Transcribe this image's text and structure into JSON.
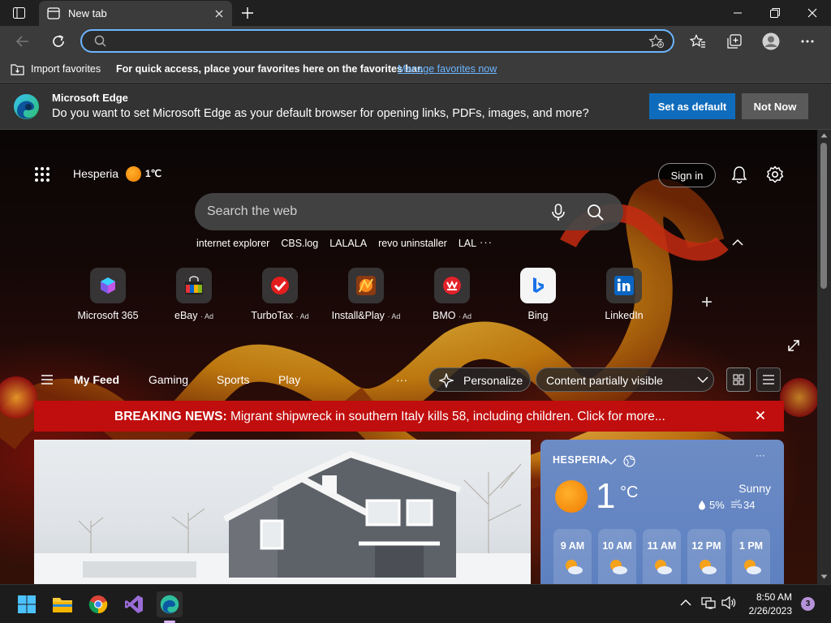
{
  "browser": {
    "tab_title": "New tab",
    "address_value": "",
    "address_placeholder": ""
  },
  "favorites_bar": {
    "import_label": "Import favorites",
    "hint": "For quick access, place your favorites here on the favorites bar.",
    "manage_link": "Manage favorites now"
  },
  "infobar": {
    "title": "Microsoft Edge",
    "message": "Do you want to set Microsoft Edge as your default browser for opening links, PDFs, images, and more?",
    "set_default": "Set as default",
    "not_now": "Not Now"
  },
  "page": {
    "location": "Hesperia",
    "temp_small": "1℃",
    "sign_in": "Sign in",
    "search_placeholder": "Search the web",
    "trending": [
      "internet explorer",
      "CBS.log",
      "LALALA",
      "revo uninstaller",
      "LAL"
    ],
    "more": "···"
  },
  "quick_links": [
    {
      "label": "Microsoft 365",
      "ad": ""
    },
    {
      "label": "eBay",
      "ad": "· Ad"
    },
    {
      "label": "TurboTax",
      "ad": "· Ad"
    },
    {
      "label": "Install&Play",
      "ad": "· Ad"
    },
    {
      "label": "BMO",
      "ad": "· Ad"
    },
    {
      "label": "Bing",
      "ad": ""
    },
    {
      "label": "LinkedIn",
      "ad": ""
    }
  ],
  "feed": {
    "tabs": [
      "My Feed",
      "Gaming",
      "Sports",
      "Play"
    ],
    "more": "···",
    "personalize": "Personalize",
    "content_visibility": "Content partially visible"
  },
  "breaking_news": {
    "label": "BREAKING NEWS:",
    "text": "Migrant shipwreck in southern Italy kills 58, including children. Click for more..."
  },
  "weather": {
    "location": "HESPERIA",
    "temp": "1",
    "unit": "°C",
    "condition": "Sunny",
    "precip": "5%",
    "wind": "34",
    "more": "···",
    "hours": [
      "9 AM",
      "10 AM",
      "11 AM",
      "12 PM",
      "1 PM"
    ]
  },
  "taskbar": {
    "time": "8:50 AM",
    "date": "2/26/2023",
    "notifications": "3"
  },
  "colors": {
    "accent": "#0f6cbd",
    "address_focus": "#6cb5ff",
    "breaking_news": "#c00d0d",
    "weather_card": "#5d80c0"
  }
}
